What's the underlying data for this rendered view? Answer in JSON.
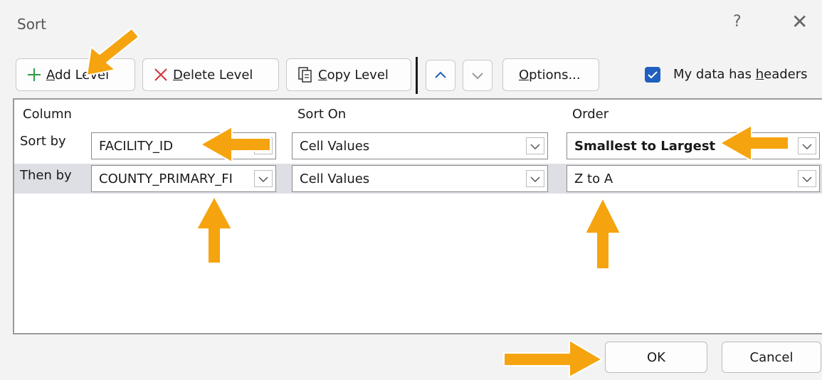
{
  "dialog": {
    "title": "Sort",
    "help": "?",
    "close": "✕"
  },
  "toolbar": {
    "add_level_pre": "",
    "add_level_u": "A",
    "add_level_post": "dd Level",
    "delete_level_u": "D",
    "delete_level_post": "elete Level",
    "copy_level_u": "C",
    "copy_level_post": "opy Level",
    "options_u": "O",
    "options_post": "ptions...",
    "headers_pre": "My data has ",
    "headers_u": "h",
    "headers_post": "eaders"
  },
  "grid": {
    "headers": {
      "column": "Column",
      "sort_on": "Sort On",
      "order": "Order"
    },
    "rows": [
      {
        "label": "Sort by",
        "column": "FACILITY_ID",
        "sort_on": "Cell Values",
        "order": "Smallest to Largest"
      },
      {
        "label": "Then by",
        "column": "COUNTY_PRIMARY_FI",
        "sort_on": "Cell Values",
        "order": "Z to A"
      }
    ]
  },
  "footer": {
    "ok": "OK",
    "cancel": "Cancel"
  },
  "colors": {
    "annotation_arrow": "#f5a40f",
    "checkbox": "#1f5fbf",
    "add_icon": "#2e9b45",
    "delete_icon": "#d13438"
  },
  "annotations": {
    "arrow_count": 6
  }
}
